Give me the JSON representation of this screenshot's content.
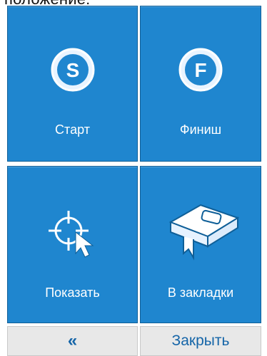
{
  "header": {
    "caption": "положение:"
  },
  "tiles": [
    {
      "label": "Старт",
      "icon": "start-s-icon",
      "icon_letter": "S"
    },
    {
      "label": "Финиш",
      "icon": "finish-f-icon",
      "icon_letter": "F"
    },
    {
      "label": "Показать",
      "icon": "crosshair-pointer-icon"
    },
    {
      "label": "В закладки",
      "icon": "bookmark-book-icon"
    }
  ],
  "footer": {
    "back_label": "«",
    "close_label": "Закрыть"
  },
  "colors": {
    "tile_blue": "#1f86cf",
    "footer_gray": "#e8e8e8",
    "footer_text": "#1565a8"
  }
}
